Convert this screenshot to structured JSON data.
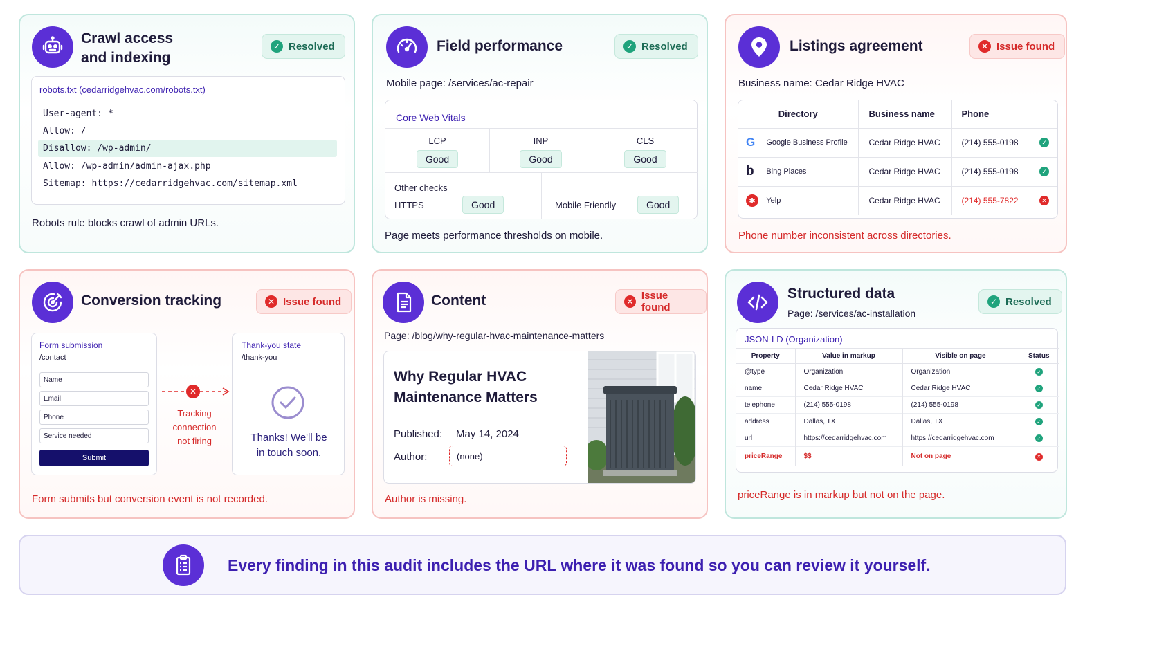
{
  "crawl": {
    "title_line1": "Crawl access",
    "title_line2": "and indexing",
    "badge": "Resolved",
    "file_label": "robots.txt (cedarridgehvac.com/robots.txt)",
    "lines": [
      "User-agent: *",
      "Allow: /",
      "Disallow: /wp-admin/",
      "Allow: /wp-admin/admin-ajax.php",
      "Sitemap: https://cedarridgehvac.com/sitemap.xml"
    ],
    "note": "Robots rule blocks crawl of admin URLs."
  },
  "field": {
    "title": "Field performance",
    "badge": "Resolved",
    "page": "Mobile page: /services/ac-repair",
    "cwv_label": "Core Web Vitals",
    "metrics": [
      {
        "name": "LCP",
        "value": "Good"
      },
      {
        "name": "INP",
        "value": "Good"
      },
      {
        "name": "CLS",
        "value": "Good"
      }
    ],
    "other_label": "Other checks",
    "other": [
      {
        "name": "HTTPS",
        "value": "Good"
      },
      {
        "name": "Mobile Friendly",
        "value": "Good"
      }
    ],
    "note": "Page meets performance thresholds on mobile."
  },
  "listings": {
    "title": "Listings agreement",
    "badge": "Issue found",
    "business": "Business name: Cedar Ridge HVAC",
    "headers": [
      "Directory",
      "Business name",
      "Phone"
    ],
    "rows": [
      {
        "directory": "Google Business Profile",
        "name": "Cedar Ridge HVAC",
        "phone": "(214) 555-0198",
        "status": "ok"
      },
      {
        "directory": "Bing Places",
        "name": "Cedar Ridge HVAC",
        "phone": "(214) 555-0198",
        "status": "ok"
      },
      {
        "directory": "Yelp",
        "name": "Cedar Ridge HVAC",
        "phone": "(214) 555-7822",
        "status": "bad"
      }
    ],
    "note": "Phone number inconsistent across directories."
  },
  "conversion": {
    "title": "Conversion tracking",
    "badge": "Issue found",
    "form_label": "Form submission",
    "form_path": "/contact",
    "fields": [
      "Name",
      "Email",
      "Phone",
      "Service needed"
    ],
    "submit": "Submit",
    "tracking_line1": "Tracking",
    "tracking_line2": "connection",
    "tracking_line3": "not firing",
    "thanks_label": "Thank-you state",
    "thanks_path": "/thank-you",
    "thanks_line1": "Thanks! We'll be",
    "thanks_line2": "in touch soon.",
    "note": "Form submits but conversion event is not recorded."
  },
  "content": {
    "title": "Content",
    "badge": "Issue found",
    "page": "Page: /blog/why-regular-hvac-maintenance-matters",
    "article_line1": "Why Regular HVAC",
    "article_line2": "Maintenance Matters",
    "published_label": "Published:",
    "published_value": "May 14, 2024",
    "author_label": "Author:",
    "author_value": "(none)",
    "note": "Author is missing."
  },
  "structured": {
    "title": "Structured data",
    "badge": "Resolved",
    "page": "Page: /services/ac-installation",
    "panel_label": "JSON-LD (Organization)",
    "headers": [
      "Property",
      "Value in markup",
      "Visible on page",
      "Status"
    ],
    "rows": [
      {
        "prop": "@type",
        "markup": "Organization",
        "visible": "Organization",
        "status": "ok"
      },
      {
        "prop": "name",
        "markup": "Cedar Ridge HVAC",
        "visible": "Cedar Ridge HVAC",
        "status": "ok"
      },
      {
        "prop": "telephone",
        "markup": "(214) 555-0198",
        "visible": "(214) 555-0198",
        "status": "ok"
      },
      {
        "prop": "address",
        "markup": "Dallas, TX",
        "visible": "Dallas, TX",
        "status": "ok"
      },
      {
        "prop": "url",
        "markup": "https://cedarridgehvac.com",
        "visible": "https://cedarridgehvac.com",
        "status": "ok"
      },
      {
        "prop": "priceRange",
        "markup": "$$",
        "visible": "Not on page",
        "status": "bad"
      }
    ],
    "note": "priceRange is in markup but not on the page."
  },
  "banner": {
    "text": "Every finding in this audit includes the URL where it was found so you can review it yourself."
  },
  "colors": {
    "accent": "#5b2fd6",
    "ok": "#1fa37c",
    "bad": "#e02a2a"
  }
}
